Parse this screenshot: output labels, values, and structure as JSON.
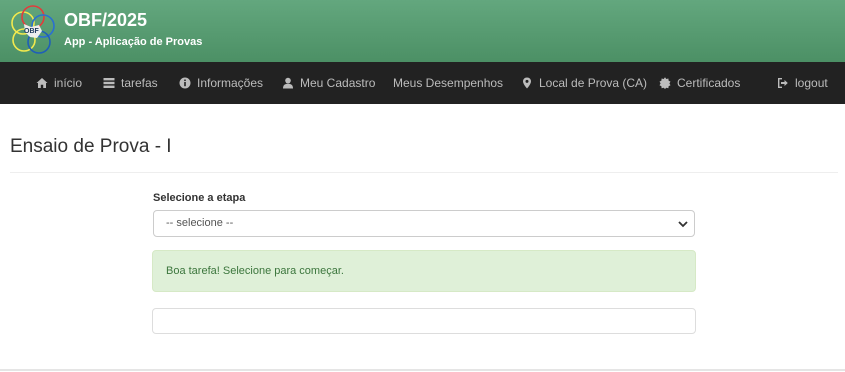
{
  "header": {
    "title": "OBF/2025",
    "subtitle": "App - Aplicação de Provas",
    "logo_text": "OBF"
  },
  "nav": {
    "items": [
      {
        "label": "início",
        "icon": "home-icon"
      },
      {
        "label": "tarefas",
        "icon": "tasks-icon"
      },
      {
        "label": "Informações",
        "icon": "info-icon"
      },
      {
        "label": "Meu Cadastro",
        "icon": "user-icon"
      },
      {
        "label": "Meus Desempenhos",
        "icon": ""
      },
      {
        "label": "Local de Prova (CA)",
        "icon": "map-marker-icon"
      },
      {
        "label": "Certificados",
        "icon": "certificate-icon"
      },
      {
        "label": "logout",
        "icon": "logout-icon"
      }
    ]
  },
  "page": {
    "title": "Ensaio de Prova - I"
  },
  "form": {
    "stage_label": "Selecione a etapa",
    "stage_select_value": "-- selecione --"
  },
  "alert": {
    "message": "Boa tarefa! Selecione para começar."
  },
  "colors": {
    "header_green": "#5a9e73",
    "navbar_bg": "#222222",
    "alert_bg": "#dff0d8",
    "alert_text": "#3c763d"
  }
}
